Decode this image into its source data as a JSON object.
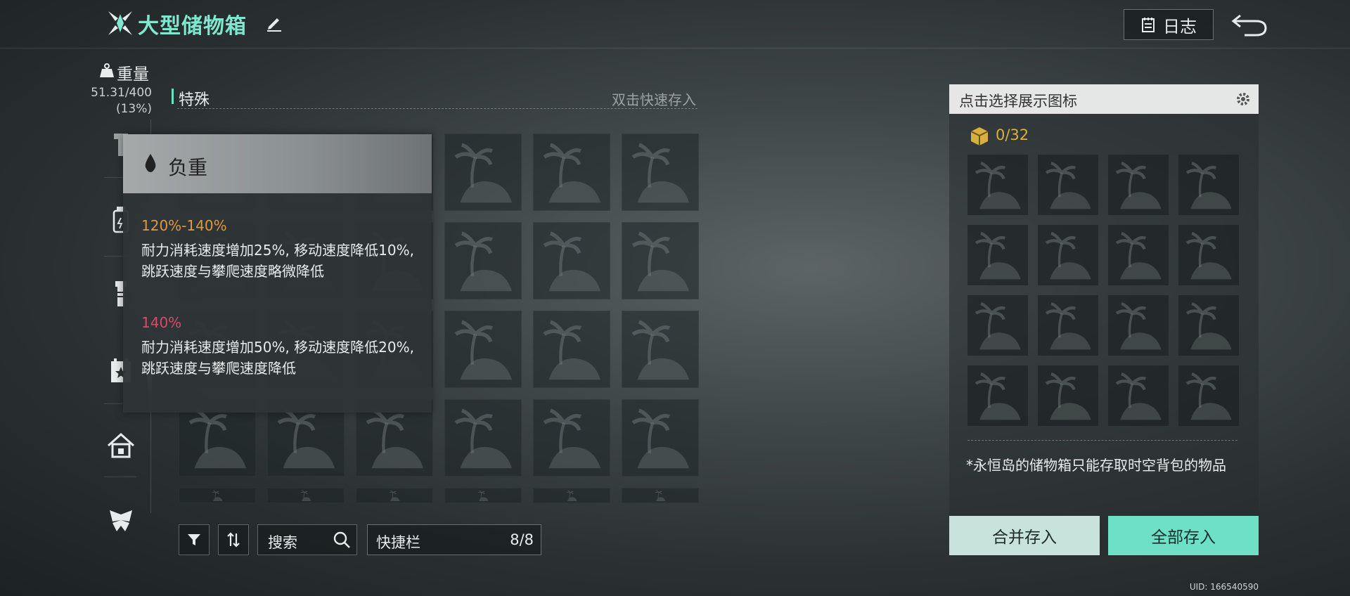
{
  "header": {
    "title": "大型储物箱",
    "log_label": "日志"
  },
  "weight": {
    "label": "重量",
    "value": "51.31/400",
    "percent": "(13%)"
  },
  "section": {
    "title": "特殊",
    "hint": "双击快速存入"
  },
  "tooltip": {
    "title": "负重",
    "tiers": [
      {
        "range": "120%-140%",
        "range_color": "#e09a3a",
        "description": "耐力消耗速度增加25%, 移动速度降低10%, 跳跃速度与攀爬速度略微降低"
      },
      {
        "range": "140%",
        "range_color": "#e0466a",
        "description": "耐力消耗速度增加50%, 移动速度降低20%, 跳跃速度与攀爬速度降低"
      }
    ]
  },
  "toolbar": {
    "search_label": "搜索",
    "quickbar_label": "快捷栏",
    "quickbar_count": "8/8"
  },
  "storage": {
    "icon_select_label": "点击选择展示图标",
    "capacity": "0/32",
    "note": "*永恒岛的储物箱只能存取时空背包的物品",
    "merge_button": "合并存入",
    "all_button": "全部存入"
  },
  "uid": "UID: 166540590",
  "colors": {
    "accent": "#6fe0c8",
    "warning": "#e09a3a",
    "danger": "#e0466a",
    "capacity": "#d7b040"
  },
  "icons": [
    "logo-icon",
    "edit-icon",
    "log-icon",
    "back-icon",
    "weight-icon",
    "tool-icon",
    "bottle-icon",
    "flashlight-icon",
    "star-calendar-icon",
    "home-icon",
    "butterfly-icon",
    "filter-icon",
    "sort-icon",
    "search-icon",
    "gear-icon",
    "box-icon",
    "drop-icon",
    "palm-island-icon"
  ]
}
